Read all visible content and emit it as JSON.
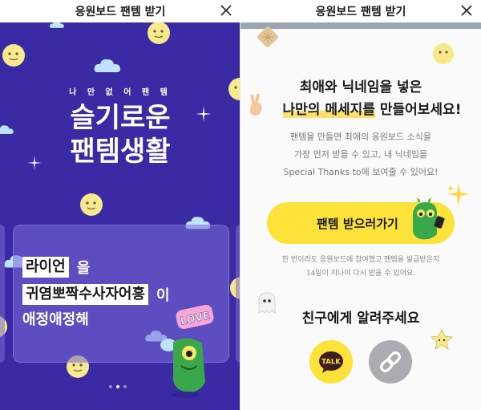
{
  "left_modal": {
    "title": "응원보드 팬템 받기",
    "close_label": "close"
  },
  "promo": {
    "kicker": "나 만 없 어 팬 템",
    "headline_line1": "슬기로운",
    "headline_line2": "팬템생활",
    "card": {
      "tag1": "라이언",
      "tag1_suffix": "을",
      "tag2": "귀염뽀짝수사자어흥",
      "tag2_suffix": "이",
      "line3": "애정애정해"
    },
    "sticker_text": "LOVE",
    "pagination": {
      "total": 3,
      "active_index": 1
    }
  },
  "right_modal": {
    "title": "응원보드 팬템 받기",
    "heading_line1": "최애와 닉네임을 넣은",
    "heading_highlight": "나만의 메세지를",
    "heading_line2_rest": " 만들어보세요!",
    "description_line1": "팬템을 만들면 최애의 응원보드 소식을",
    "description_line2": "가장 먼저 받을 수 있고, 내 닉네임을",
    "description_line3": "Special Thanks to에 보여줄 수 있어요!",
    "cta_label": "팬템 받으러가기",
    "note_line1": "한 번이라도 응원보드에 참여했고 팬템을 발급받은지",
    "note_line2": "14일이 지나야 다시 받을 수 있어요.",
    "share_title": "친구에게 알려주세요",
    "kakao_label": "TALK"
  },
  "colors": {
    "promo_bg": "#3a2aa4",
    "accent_yellow": "#fde23a",
    "link_gray": "#a9adb1"
  },
  "icons": [
    "close-icon",
    "moon-icon",
    "cloud-icon",
    "sparkle-icon",
    "kakaotalk-icon",
    "link-icon",
    "character-icon",
    "ghost-icon",
    "hand-v-icon"
  ]
}
